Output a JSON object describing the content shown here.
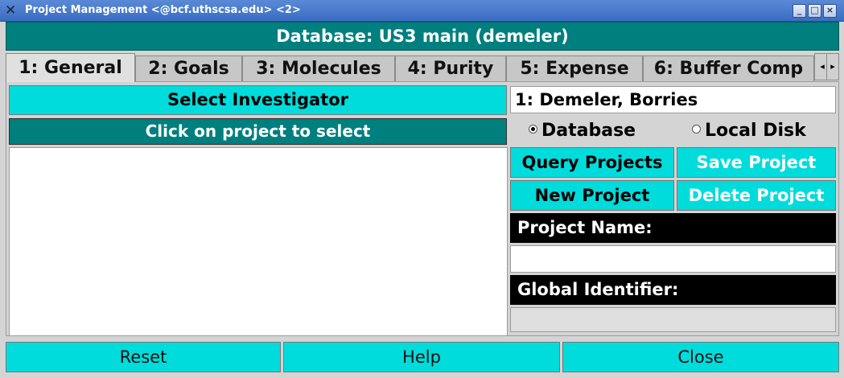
{
  "window": {
    "title": "Project Management <@bcf.uthscsa.edu> <2>",
    "minimize": "_",
    "maximize": "□",
    "close": "×"
  },
  "header": {
    "database_label": "Database: US3 main (demeler)"
  },
  "tabs": [
    {
      "label": "1: General"
    },
    {
      "label": "2: Goals"
    },
    {
      "label": "3: Molecules"
    },
    {
      "label": "4: Purity"
    },
    {
      "label": "5: Expense"
    },
    {
      "label": "6: Buffer Comp"
    }
  ],
  "general": {
    "select_investigator": "Select Investigator",
    "investigator_value": "1: Demeler, Borries",
    "click_instruction": "Click on project to select",
    "source": {
      "database": "Database",
      "local_disk": "Local Disk",
      "selected": "database"
    },
    "query_projects": "Query Projects",
    "save_project": "Save Project",
    "new_project": "New Project",
    "delete_project": "Delete Project",
    "project_name_label": "Project Name:",
    "project_name_value": "",
    "global_identifier_label": "Global Identifier:",
    "global_identifier_value": ""
  },
  "footer": {
    "reset": "Reset",
    "help": "Help",
    "close": "Close"
  },
  "colors": {
    "teal": "#007f7f",
    "cyan": "#00dcdc",
    "titlebar": "#4a7bd0"
  }
}
